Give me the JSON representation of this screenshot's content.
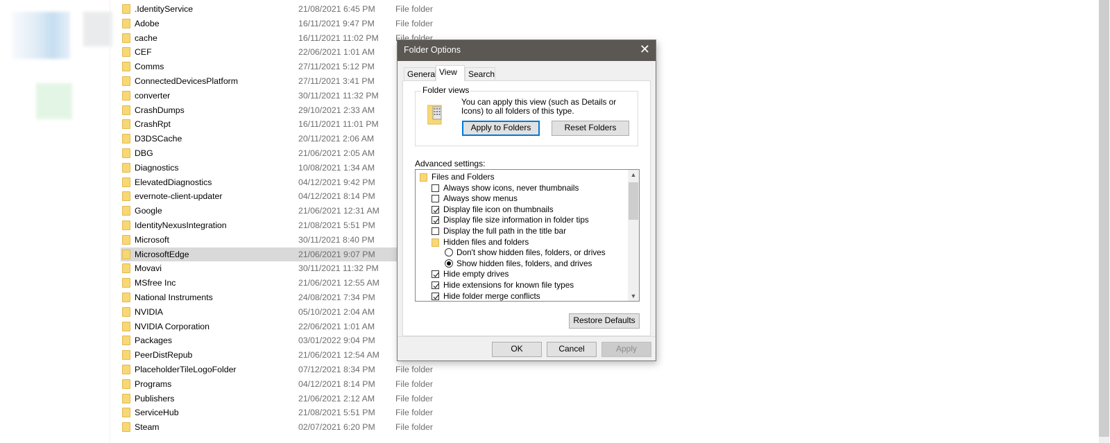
{
  "explorer": {
    "files": [
      {
        "name": ".IdentityService",
        "date": "21/08/2021 6:45 PM",
        "type": "File folder"
      },
      {
        "name": "Adobe",
        "date": "16/11/2021 9:47 PM",
        "type": "File folder"
      },
      {
        "name": "cache",
        "date": "16/11/2021 11:02 PM",
        "type": "File folder"
      },
      {
        "name": "CEF",
        "date": "22/06/2021 1:01 AM",
        "type": ""
      },
      {
        "name": "Comms",
        "date": "27/11/2021 5:12 PM",
        "type": ""
      },
      {
        "name": "ConnectedDevicesPlatform",
        "date": "27/11/2021 3:41 PM",
        "type": ""
      },
      {
        "name": "converter",
        "date": "30/11/2021 11:32 PM",
        "type": ""
      },
      {
        "name": "CrashDumps",
        "date": "29/10/2021 2:33 AM",
        "type": ""
      },
      {
        "name": "CrashRpt",
        "date": "16/11/2021 11:01 PM",
        "type": ""
      },
      {
        "name": "D3DSCache",
        "date": "20/11/2021 2:06 AM",
        "type": ""
      },
      {
        "name": "DBG",
        "date": "21/06/2021 2:05 AM",
        "type": ""
      },
      {
        "name": "Diagnostics",
        "date": "10/08/2021 1:34 AM",
        "type": ""
      },
      {
        "name": "ElevatedDiagnostics",
        "date": "04/12/2021 9:42 PM",
        "type": ""
      },
      {
        "name": "evernote-client-updater",
        "date": "04/12/2021 8:14 PM",
        "type": ""
      },
      {
        "name": "Google",
        "date": "21/06/2021 12:31 AM",
        "type": ""
      },
      {
        "name": "IdentityNexusIntegration",
        "date": "21/08/2021 5:51 PM",
        "type": ""
      },
      {
        "name": "Microsoft",
        "date": "30/11/2021 8:40 PM",
        "type": ""
      },
      {
        "name": "MicrosoftEdge",
        "date": "21/06/2021 9:07 PM",
        "type": "",
        "selected": true
      },
      {
        "name": "Movavi",
        "date": "30/11/2021 11:32 PM",
        "type": ""
      },
      {
        "name": "MSfree Inc",
        "date": "21/06/2021 12:55 AM",
        "type": ""
      },
      {
        "name": "National Instruments",
        "date": "24/08/2021 7:34 PM",
        "type": ""
      },
      {
        "name": "NVIDIA",
        "date": "05/10/2021 2:04 AM",
        "type": ""
      },
      {
        "name": "NVIDIA Corporation",
        "date": "22/06/2021 1:01 AM",
        "type": ""
      },
      {
        "name": "Packages",
        "date": "03/01/2022 9:04 PM",
        "type": ""
      },
      {
        "name": "PeerDistRepub",
        "date": "21/06/2021 12:54 AM",
        "type": ""
      },
      {
        "name": "PlaceholderTileLogoFolder",
        "date": "07/12/2021 8:34 PM",
        "type": "File folder"
      },
      {
        "name": "Programs",
        "date": "04/12/2021 8:14 PM",
        "type": "File folder"
      },
      {
        "name": "Publishers",
        "date": "21/06/2021 2:12 AM",
        "type": "File folder"
      },
      {
        "name": "ServiceHub",
        "date": "21/08/2021 5:51 PM",
        "type": "File folder"
      },
      {
        "name": "Steam",
        "date": "02/07/2021 6:20 PM",
        "type": "File folder"
      }
    ]
  },
  "dialog": {
    "title": "Folder Options",
    "close_glyph": "✕",
    "tabs": [
      "General",
      "View",
      "Search"
    ],
    "active_tab": "View",
    "folder_views": {
      "legend": "Folder views",
      "text": "You can apply this view (such as Details or Icons) to all folders of this type.",
      "apply_label": "Apply to Folders",
      "reset_label": "Reset Folders"
    },
    "advanced_label": "Advanced settings:",
    "settings": [
      {
        "kind": "folder",
        "label": "Files and Folders",
        "indent": 0
      },
      {
        "kind": "checkbox",
        "label": "Always show icons, never thumbnails",
        "checked": false,
        "indent": 1
      },
      {
        "kind": "checkbox",
        "label": "Always show menus",
        "checked": false,
        "indent": 1
      },
      {
        "kind": "checkbox",
        "label": "Display file icon on thumbnails",
        "checked": true,
        "indent": 1
      },
      {
        "kind": "checkbox",
        "label": "Display file size information in folder tips",
        "checked": true,
        "indent": 1
      },
      {
        "kind": "checkbox",
        "label": "Display the full path in the title bar",
        "checked": false,
        "indent": 1
      },
      {
        "kind": "folder",
        "label": "Hidden files and folders",
        "indent": 1
      },
      {
        "kind": "radio",
        "label": "Don't show hidden files, folders, or drives",
        "checked": false,
        "indent": 2
      },
      {
        "kind": "radio",
        "label": "Show hidden files, folders, and drives",
        "checked": true,
        "indent": 2
      },
      {
        "kind": "checkbox",
        "label": "Hide empty drives",
        "checked": true,
        "indent": 1
      },
      {
        "kind": "checkbox",
        "label": "Hide extensions for known file types",
        "checked": true,
        "indent": 1
      },
      {
        "kind": "checkbox",
        "label": "Hide folder merge conflicts",
        "checked": true,
        "indent": 1
      }
    ],
    "restore_label": "Restore Defaults",
    "ok_label": "OK",
    "cancel_label": "Cancel",
    "apply_label": "Apply"
  }
}
